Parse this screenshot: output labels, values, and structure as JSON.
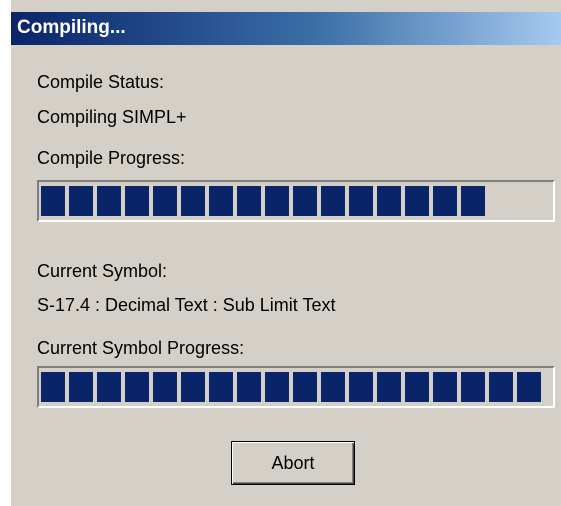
{
  "window": {
    "title": "Compiling..."
  },
  "compile_status": {
    "label": "Compile Status:",
    "value": "Compiling SIMPL+"
  },
  "compile_progress": {
    "label": "Compile Progress:",
    "progress_percent": 88
  },
  "current_symbol": {
    "label": "Current Symbol:",
    "value": "S-17.4 : Decimal Text : Sub Limit Text"
  },
  "symbol_progress": {
    "label": "Current Symbol Progress:",
    "progress_percent": 100
  },
  "buttons": {
    "abort_label": "Abort"
  },
  "colors": {
    "progress_fill": "#0a246a",
    "dialog_bg": "#d4d0c8",
    "title_start": "#0a246a",
    "title_end": "#a6caf0"
  }
}
